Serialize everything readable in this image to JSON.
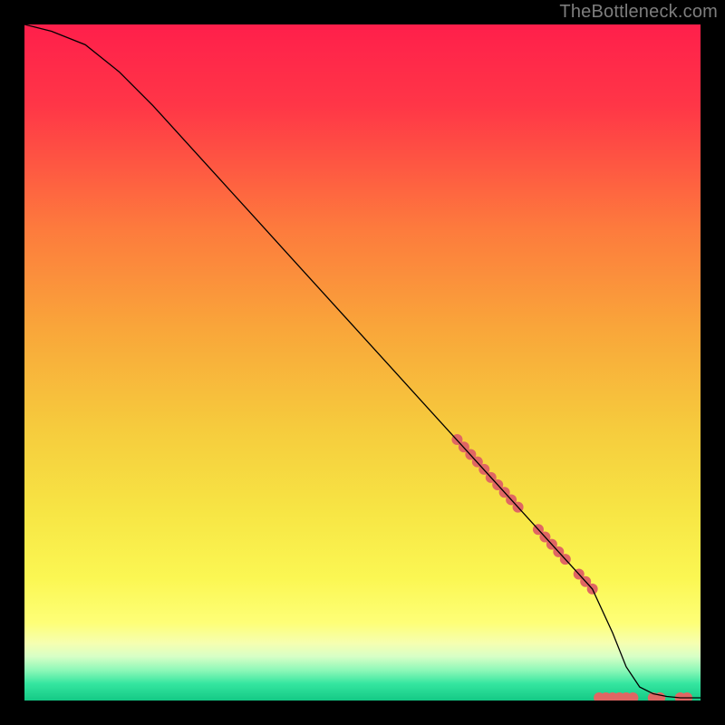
{
  "watermark": "TheBottleneck.com",
  "chart_data": {
    "type": "line",
    "title": "",
    "xlabel": "",
    "ylabel": "",
    "xlim": [
      0,
      100
    ],
    "ylim": [
      0,
      100
    ],
    "x": [
      0,
      4,
      9,
      14,
      19,
      24,
      29,
      34,
      39,
      44,
      49,
      54,
      59,
      64,
      69,
      74,
      79,
      84,
      87,
      89,
      91,
      93,
      95,
      97,
      100
    ],
    "values": [
      100,
      99,
      97,
      93,
      88,
      82.5,
      77,
      71.5,
      66,
      60.5,
      55,
      49.5,
      44,
      38.5,
      33,
      27.5,
      22,
      16.5,
      10,
      5,
      2,
      1,
      0.6,
      0.4,
      0.4
    ],
    "dot_points": {
      "x": [
        64,
        65,
        66,
        67,
        68,
        69,
        70,
        71,
        72,
        73,
        76,
        77,
        78,
        79,
        80,
        82,
        83,
        84,
        85,
        86,
        87,
        88,
        89,
        90,
        93,
        94,
        97,
        98
      ],
      "y": [
        38.6,
        37.5,
        36.4,
        35.3,
        34.2,
        33.0,
        31.9,
        30.8,
        29.7,
        28.6,
        25.3,
        24.2,
        23.1,
        22.0,
        20.9,
        18.7,
        17.6,
        16.5,
        0.4,
        0.4,
        0.4,
        0.4,
        0.4,
        0.4,
        0.4,
        0.4,
        0.4,
        0.4
      ]
    },
    "gradient_stops": [
      {
        "offset": 0,
        "color": "#ff1f4b"
      },
      {
        "offset": 0.12,
        "color": "#ff3647"
      },
      {
        "offset": 0.3,
        "color": "#fd7a3d"
      },
      {
        "offset": 0.45,
        "color": "#f9a63a"
      },
      {
        "offset": 0.6,
        "color": "#f6cc3d"
      },
      {
        "offset": 0.72,
        "color": "#f7e544"
      },
      {
        "offset": 0.82,
        "color": "#fbf753"
      },
      {
        "offset": 0.885,
        "color": "#feff77"
      },
      {
        "offset": 0.915,
        "color": "#f6ffb0"
      },
      {
        "offset": 0.935,
        "color": "#d7ffc6"
      },
      {
        "offset": 0.955,
        "color": "#8ef8b8"
      },
      {
        "offset": 0.975,
        "color": "#35e6a0"
      },
      {
        "offset": 1.0,
        "color": "#14c985"
      }
    ],
    "dot_color": "#e06663",
    "line_color": "#000000"
  }
}
